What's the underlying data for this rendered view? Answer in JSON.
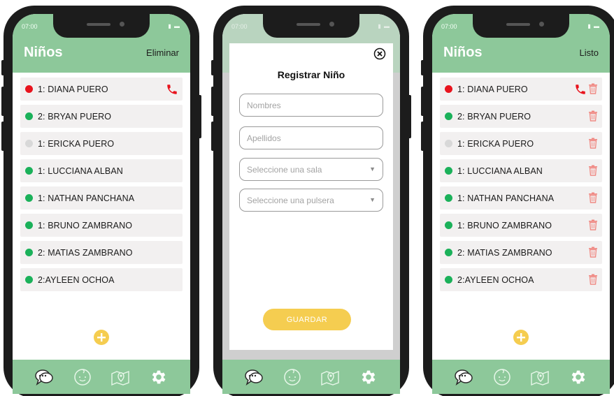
{
  "colors": {
    "header": "#8dc89a",
    "status_red": "#e8131d",
    "status_green": "#1bb15a",
    "status_grey": "#d8d8d8",
    "call_icon": "#e8131d",
    "trash_icon": "#f08a84",
    "add_button": "#f5cd50"
  },
  "screens": {
    "list": {
      "status_time": "07:00",
      "title": "Niños",
      "action_label": "Eliminar"
    },
    "form": {
      "status_time": "07:00",
      "modal_title": "Registrar Niño",
      "names_placeholder": "Nombres",
      "surnames_placeholder": "Apellidos",
      "room_select": "Seleccione una sala",
      "bracelet_select": "Seleccione una pulsera",
      "save_label": "GUARDAR"
    },
    "edit": {
      "status_time": "07:00",
      "title": "Niños",
      "action_label": "Listo"
    }
  },
  "children": [
    {
      "name": "1: DIANA PUERO",
      "status": "red",
      "call": true
    },
    {
      "name": "2: BRYAN PUERO",
      "status": "green",
      "call": false
    },
    {
      "name": "1: ERICKA PUERO",
      "status": "grey",
      "call": false
    },
    {
      "name": "1: LUCCIANA ALBAN",
      "status": "green",
      "call": false
    },
    {
      "name": "1: NATHAN PANCHANA",
      "status": "green",
      "call": false
    },
    {
      "name": "1: BRUNO ZAMBRANO",
      "status": "green",
      "call": false
    },
    {
      "name": "2: MATIAS ZAMBRANO",
      "status": "green",
      "call": false
    },
    {
      "name": "2:AYLEEN OCHOA",
      "status": "green",
      "call": false
    }
  ],
  "bottom_nav": [
    "chat-icon",
    "baby-icon",
    "map-icon",
    "gear-icon"
  ]
}
